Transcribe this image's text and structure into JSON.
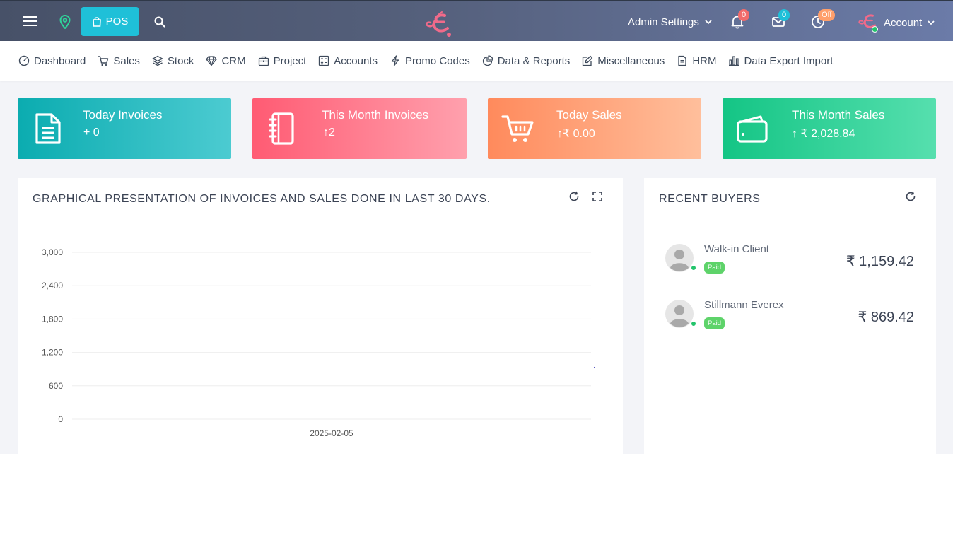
{
  "topbar": {
    "pos_label": "POS",
    "admin_settings_label": "Admin Settings",
    "notifications_count": "0",
    "messages_count": "0",
    "clock_status": "Off",
    "account_label": "Account"
  },
  "nav": {
    "items": [
      {
        "label": "Dashboard",
        "icon": "gauge-icon"
      },
      {
        "label": "Sales",
        "icon": "cart-icon"
      },
      {
        "label": "Stock",
        "icon": "layers-icon"
      },
      {
        "label": "CRM",
        "icon": "diamond-icon"
      },
      {
        "label": "Project",
        "icon": "briefcase-icon"
      },
      {
        "label": "Accounts",
        "icon": "calculator-icon"
      },
      {
        "label": "Promo Codes",
        "icon": "bolt-icon"
      },
      {
        "label": "Data & Reports",
        "icon": "pie-icon"
      },
      {
        "label": "Miscellaneous",
        "icon": "edit-icon"
      },
      {
        "label": "HRM",
        "icon": "file-icon"
      },
      {
        "label": "Data Export Import",
        "icon": "bar-chart-icon"
      }
    ]
  },
  "stats": [
    {
      "title": "Today Invoices",
      "value": "+ 0",
      "icon": "document-icon",
      "color_from": "#0bacb0",
      "color_to": "#4ccbd1"
    },
    {
      "title": "This Month Invoices",
      "value": "↑2",
      "icon": "notebook-icon",
      "color_from": "#ff5b73",
      "color_to": "#ffa0ad"
    },
    {
      "title": "Today Sales",
      "value": "↑₹ 0.00",
      "icon": "cart-icon",
      "color_from": "#ff8a5c",
      "color_to": "#ffbf9c"
    },
    {
      "title": "This Month Sales",
      "value": "↑ ₹ 2,028.84",
      "icon": "wallet-icon",
      "color_from": "#14c585",
      "color_to": "#56dfae"
    }
  ],
  "chart_panel": {
    "title": "GRAPHICAL PRESENTATION OF INVOICES AND SALES DONE IN LAST 30 DAYS."
  },
  "chart_data": {
    "type": "line",
    "title": "GRAPHICAL PRESENTATION OF INVOICES AND SALES DONE IN LAST 30 DAYS.",
    "xlabel": "",
    "ylabel": "",
    "x_ticks": [
      "2025-02-05"
    ],
    "y_ticks": [
      "3,000",
      "2,400",
      "1,800",
      "1,200",
      "600",
      "0"
    ],
    "ylim": [
      0,
      3000
    ],
    "grid": true,
    "series": [
      {
        "color": "#3b3bb3",
        "points": [
          {
            "x": "end",
            "y": 930
          }
        ]
      }
    ]
  },
  "buyers_panel": {
    "title": "RECENT BUYERS",
    "buyers": [
      {
        "name": "Walk-in Client",
        "status": "Paid",
        "amount": "₹ 1,159.42"
      },
      {
        "name": "Stillmann Everex",
        "status": "Paid",
        "amount": "₹ 869.42"
      }
    ]
  }
}
